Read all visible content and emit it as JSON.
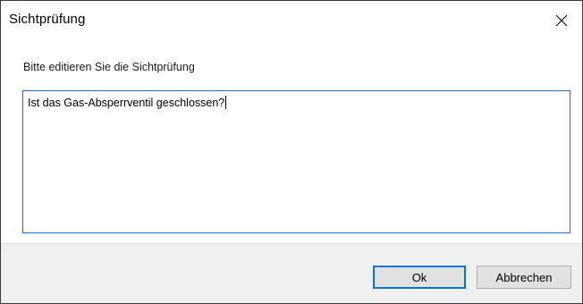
{
  "window": {
    "title": "Sichtprüfung",
    "close_icon": "close-icon"
  },
  "main": {
    "prompt": "Bitte editieren Sie die Sichtprüfung",
    "text_value": "Ist das Gas-Absperrventil geschlossen?"
  },
  "footer": {
    "ok_label": "Ok",
    "cancel_label": "Abbrechen"
  },
  "colors": {
    "focus_border": "#0078d7",
    "footer_bg": "#f0f0f0",
    "button_bg": "#e1e1e1"
  }
}
